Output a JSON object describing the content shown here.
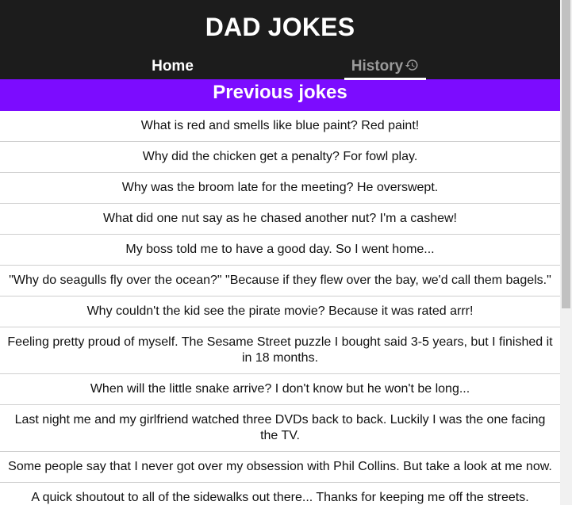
{
  "app": {
    "title": "DAD JOKES"
  },
  "nav": {
    "home_label": "Home",
    "history_label": "History",
    "active": "History"
  },
  "section": {
    "title": "Previous jokes"
  },
  "jokes": [
    "What is red and smells like blue paint? Red paint!",
    "Why did the chicken get a penalty? For fowl play.",
    "Why was the broom late for the meeting? He overswept.",
    "What did one nut say as he chased another nut? I'm a cashew!",
    "My boss told me to have a good day. So I went home...",
    "\"Why do seagulls fly over the ocean?\" \"Because if they flew over the bay, we'd call them bagels.\"",
    "Why couldn't the kid see the pirate movie? Because it was rated arrr!",
    "Feeling pretty proud of myself. The Sesame Street puzzle I bought said 3-5 years, but I finished it in 18 months.",
    "When will the little snake arrive? I don't know but he won't be long...",
    "Last night me and my girlfriend watched three DVDs back to back. Luckily I was the one facing the TV.",
    "Some people say that I never got over my obsession with Phil Collins. But take a look at me now.",
    "A quick shoutout to all of the sidewalks out there... Thanks for keeping me off the streets."
  ],
  "colors": {
    "header_bg": "#1c1c1c",
    "accent_purple": "#7c0cff",
    "inactive_tab": "#9a9a9a"
  }
}
